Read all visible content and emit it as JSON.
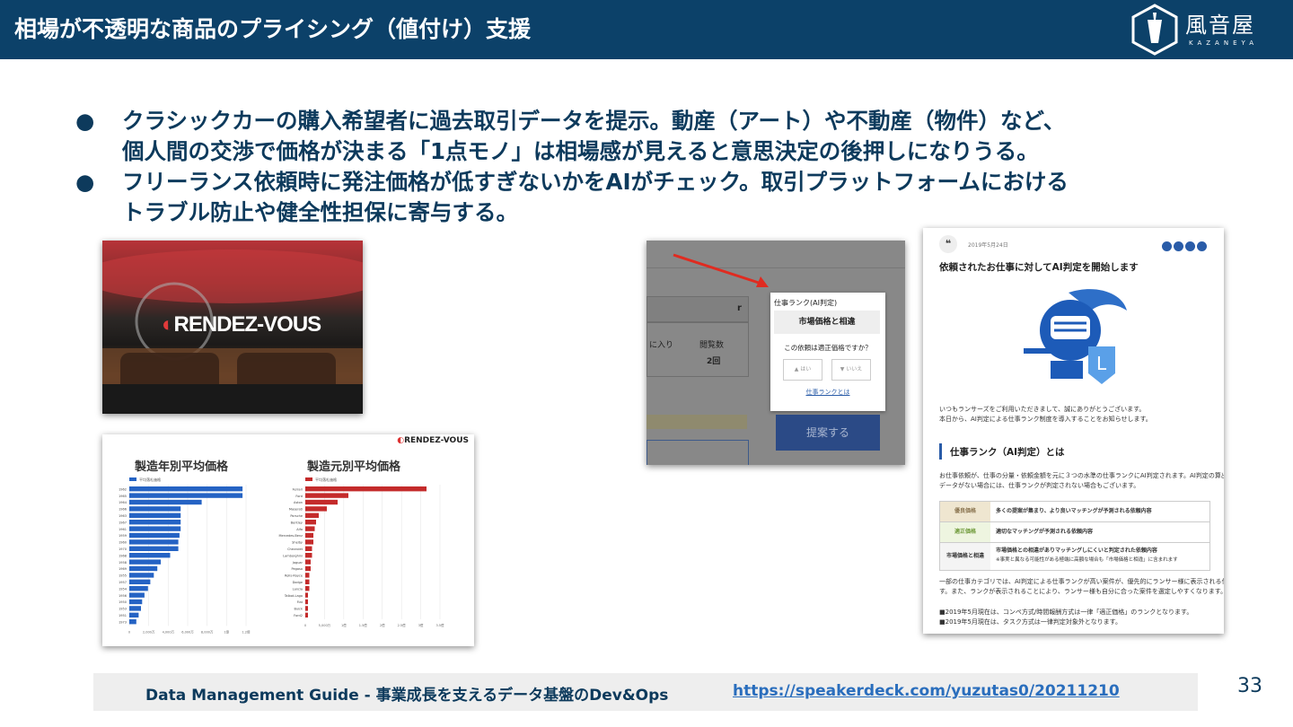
{
  "header": {
    "title": "相場が不透明な商品のプライシング（値付け）支援",
    "logo_brand": "風音屋",
    "logo_sub": "KAZANEYA"
  },
  "bullets": [
    {
      "marker": "●",
      "lines": [
        "クラシックカーの購入希望者に過去取引データを提示。動産（アート）や不動産（物件）など、",
        "個人間の交渉で価格が決まる「1点モノ」は相場感が見えると意思決定の後押しになりうる。"
      ]
    },
    {
      "marker": "●",
      "lines": [
        "フリーランス依頼時に発注価格が低すぎないかをAIがチェック。取引プラットフォームにおける",
        "トラブル防止や健全性担保に寄与する。"
      ]
    }
  ],
  "rendez_photo": {
    "logo_text": "RENDEZ-VOUS"
  },
  "charts_image": {
    "brand": "RENDEZ-VOUS",
    "charts": [
      {
        "title": "製造年別平均価格",
        "legend": "平均落札価格",
        "color": "#2563c4",
        "categories": [
          "1962",
          "1965",
          "1964",
          "1966",
          "1963",
          "1967",
          "1961",
          "1959",
          "1960",
          "1970",
          "1968",
          "1958",
          "1969",
          "1955",
          "1957",
          "1954",
          "1956",
          "1950",
          "1953",
          "1951",
          "1973"
        ],
        "values": [
          0.97,
          0.97,
          0.62,
          0.44,
          0.44,
          0.44,
          0.44,
          0.43,
          0.42,
          0.42,
          0.35,
          0.27,
          0.24,
          0.21,
          0.18,
          0.16,
          0.13,
          0.11,
          0.1,
          0.08,
          0.06
        ],
        "ticks": [
          "0",
          "2,000万",
          "4,000万",
          "6,000万",
          "8,000万",
          "1億",
          "1.2億"
        ]
      },
      {
        "title": "製造元別平均価格",
        "legend": "平均落札価格",
        "color": "#c42b2b",
        "categories": [
          "Ferrari",
          "Ford",
          "Aston",
          "Maserati",
          "Porsche",
          "Bentley",
          "Alfa",
          "Mercedes-Benz",
          "Shelby",
          "Chevrolet",
          "Lamborghini",
          "Jaguar",
          "Pegaso",
          "Rolls-Royce",
          "Dodge",
          "Lancia",
          "Talbot-Lago",
          "Fiat",
          "Buick",
          "Ford2"
        ],
        "values": [
          0.9,
          0.32,
          0.24,
          0.16,
          0.1,
          0.08,
          0.07,
          0.06,
          0.06,
          0.05,
          0.05,
          0.04,
          0.04,
          0.03,
          0.03,
          0.03,
          0.02,
          0.02,
          0.02,
          0.02
        ],
        "ticks": [
          "0",
          "5,000万",
          "1億",
          "1.5億",
          "2億",
          "2.5億",
          "3億",
          "3.5億"
        ]
      }
    ]
  },
  "lancers_ui": {
    "popup_title": "仕事ランク(AI判定)",
    "rank_label": "市場価格と相違",
    "question": "この依頼は適正価格ですか？",
    "yes": "はい",
    "no": "いいえ",
    "link": "仕事ランクとは",
    "cta": "提案する",
    "views_label": "閲覧数",
    "views_value": "2回",
    "fav_label": "に入り",
    "left_partial": "r"
  },
  "blog": {
    "date": "2019年5月24日",
    "title": "依頼されたお仕事に対してAI判定を開始します",
    "intro": [
      "いつもランサーズをご利用いただきまして、誠にありがとうございます。",
      "本日から、AI判定による仕事ランク制度を導入することをお知らせします。"
    ],
    "section_title": "仕事ランク（AI判定）とは",
    "section_body": [
      "お仕事依頼が、仕事の分量・依頼金額を元に３つの水準の仕事ランクにAI判定されます。AI判定の算出に足る",
      "データがない場合には、仕事ランクが判定されない場合もございます。"
    ],
    "table": [
      {
        "label": "優良価格",
        "desc": "多くの提案が集まり、より良いマッチングが予測される依頼内容",
        "color": "#8a7450"
      },
      {
        "label": "適正価格",
        "desc": "適切なマッチングが予測される依頼内容",
        "color": "#6f9a3a"
      },
      {
        "label": "市場価格と相違",
        "desc": "市場価格との相違がありマッチングしにくいと判定された依頼内容",
        "note": "※事実と異なる可能性がある極端に高額な場合も「市場価格と相違」に含まれます",
        "color": "#333333"
      }
    ],
    "outro": [
      "一部の仕事カテゴリでは、AI判定による仕事ランクが高い案件が、優先的にランサー様に表示される仕組みで",
      "す。また、ランクが表示されることにより、ランサー様も自分に合った案件を選定しやすくなります。"
    ],
    "notes": [
      "■2019年5月現在は、コンペ方式/時間報酬方式は一律「適正価格」のランクとなります。",
      "■2019年5月現在は、タスク方式は一律判定対象外となります。"
    ]
  },
  "footer": {
    "text": "Data Management Guide - 事業成長を支えるデータ基盤のDev&Ops",
    "link": "https://speakerdeck.com/yuzutas0/20211210"
  },
  "page_number": "33"
}
